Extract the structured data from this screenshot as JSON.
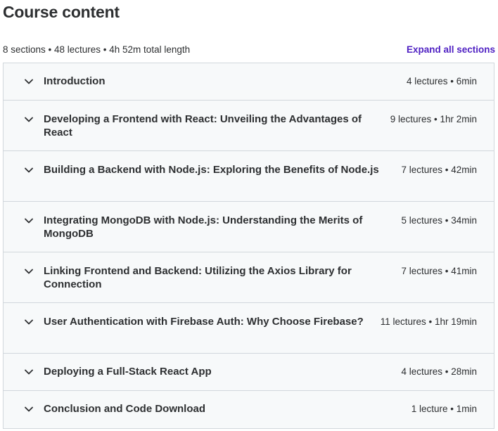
{
  "header": {
    "title": "Course content",
    "summary": "8 sections • 48 lectures • 4h 52m total length",
    "expand_all_label": "Expand all sections"
  },
  "icons": {
    "section_toggle": "chevron-down-icon"
  },
  "colors": {
    "accent": "#5022c3",
    "section_bg": "#f7f9fa",
    "border": "#d1d7dc",
    "text": "#2d2f31"
  },
  "sections": [
    {
      "title": "Introduction",
      "meta": "4 lectures • 6min"
    },
    {
      "title": "Developing a Frontend with React: Unveiling the Advantages of React",
      "meta": "9 lectures • 1hr 2min"
    },
    {
      "title": "Building a Backend with Node.js: Exploring the Benefits of Node.js",
      "meta": "7 lectures • 42min"
    },
    {
      "title": "Integrating MongoDB with Node.js: Understanding the Merits of MongoDB",
      "meta": "5 lectures • 34min"
    },
    {
      "title": "Linking Frontend and Backend: Utilizing the Axios Library for Connection",
      "meta": "7 lectures • 41min"
    },
    {
      "title": "User Authentication with Firebase Auth: Why Choose Firebase?",
      "meta": "11 lectures • 1hr 19min"
    },
    {
      "title": "Deploying a Full-Stack React App",
      "meta": "4 lectures • 28min"
    },
    {
      "title": "Conclusion and Code Download",
      "meta": "1 lecture • 1min"
    }
  ]
}
